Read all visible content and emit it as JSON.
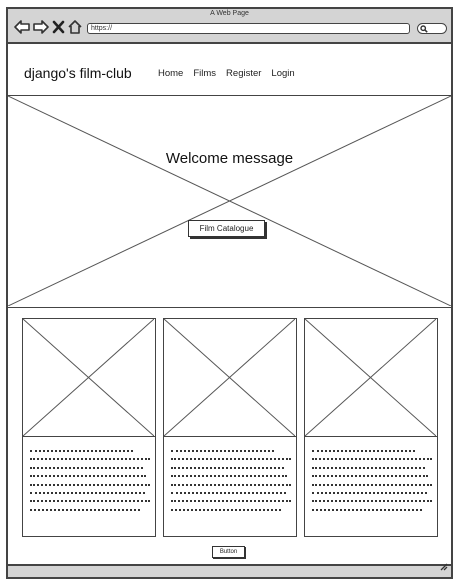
{
  "browser": {
    "title": "A Web Page",
    "address": "https://",
    "icons": [
      "back-arrow-icon",
      "forward-arrow-icon",
      "close-icon",
      "home-icon",
      "search-icon",
      "resize-grip-icon"
    ]
  },
  "header": {
    "brand": "django's film-club",
    "nav": [
      {
        "label": "Home"
      },
      {
        "label": "Films"
      },
      {
        "label": "Register"
      },
      {
        "label": "Login"
      }
    ]
  },
  "hero": {
    "welcome": "Welcome message",
    "button": "Film Catalogue"
  },
  "cards": [
    {
      "image": "image-placeholder",
      "text": "placeholder-text"
    },
    {
      "image": "image-placeholder",
      "text": "placeholder-text"
    },
    {
      "image": "image-placeholder",
      "text": "placeholder-text"
    }
  ],
  "footer": {
    "button": "Button"
  }
}
